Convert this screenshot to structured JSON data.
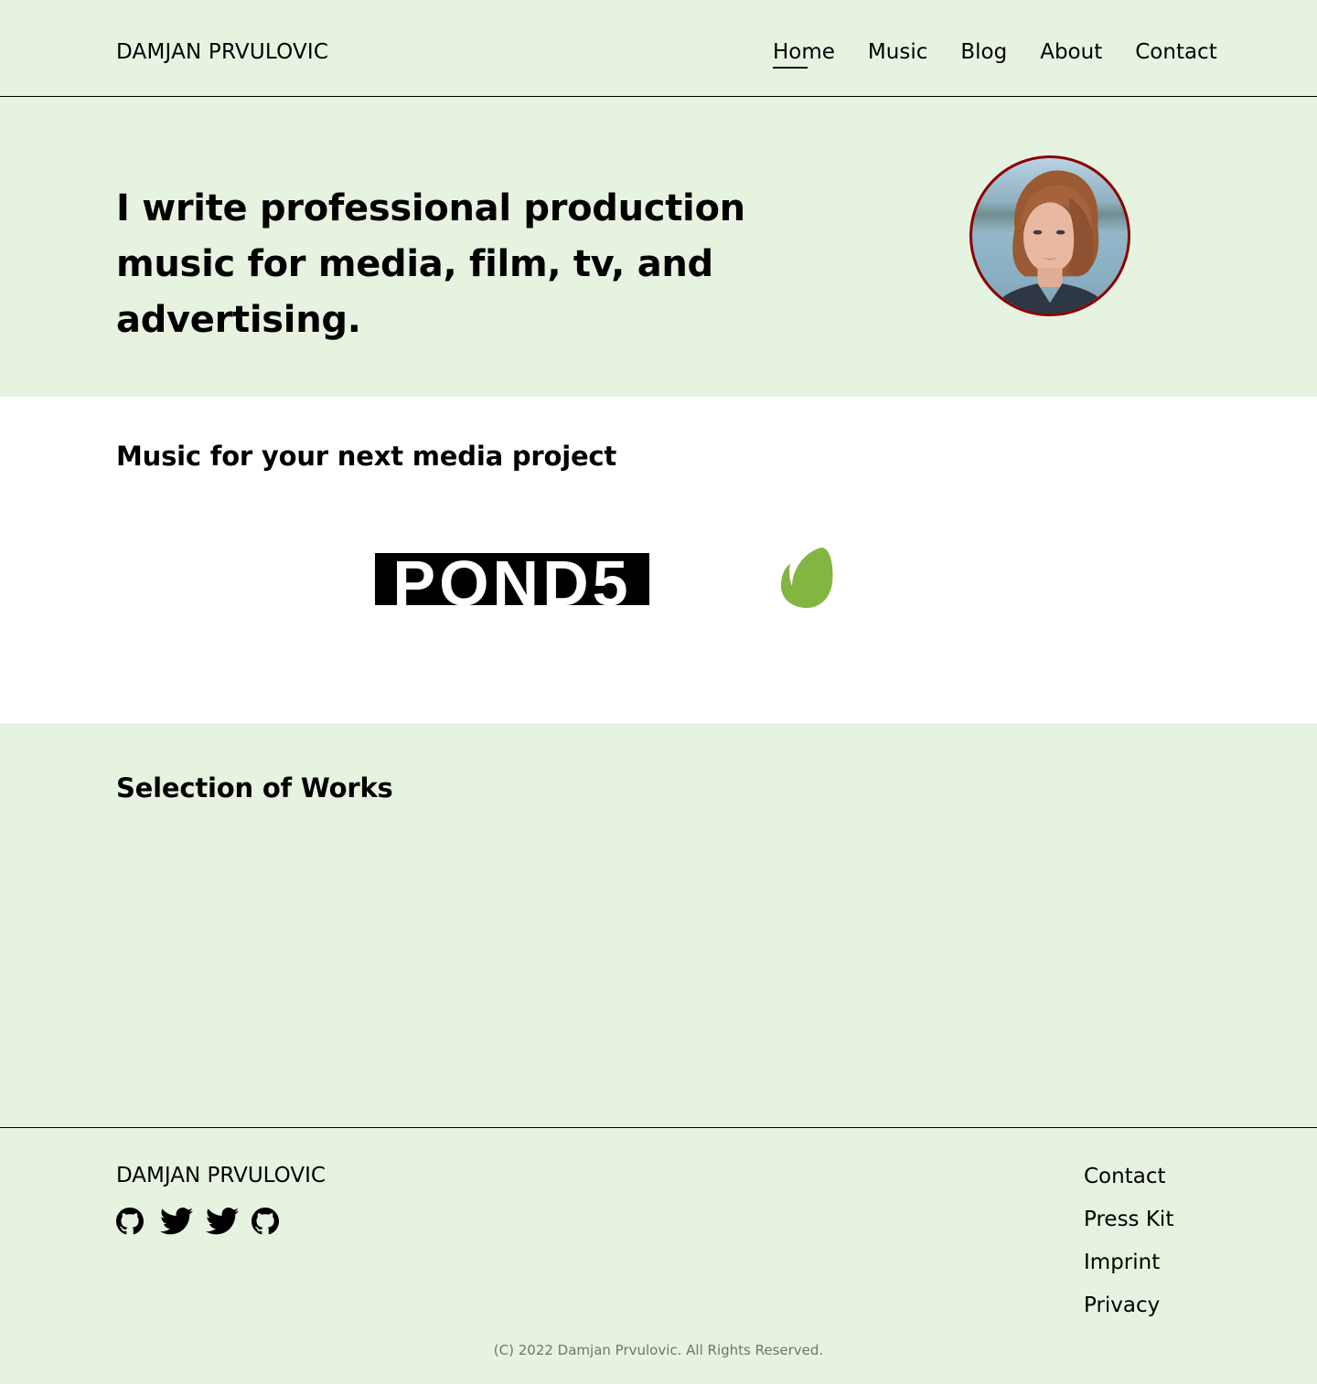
{
  "header": {
    "brand": "DAMJAN PRVULOVIC",
    "nav": [
      {
        "label": "Home",
        "active": true
      },
      {
        "label": "Music",
        "active": false
      },
      {
        "label": "Blog",
        "active": false
      },
      {
        "label": "About",
        "active": false
      },
      {
        "label": "Contact",
        "active": false
      }
    ]
  },
  "hero": {
    "title": "I write professional production music for media, film, tv, and advertising.",
    "avatar_alt": "portrait photo"
  },
  "partners": {
    "title": "Music for your next media project",
    "logos": [
      {
        "name": "Pond5",
        "text": "POND5"
      },
      {
        "name": "Envato",
        "color": "#82b541"
      }
    ]
  },
  "works": {
    "title": "Selection of Works"
  },
  "footer": {
    "brand": "DAMJAN PRVULOVIC",
    "socials": [
      {
        "icon": "github-icon"
      },
      {
        "icon": "twitter-icon"
      },
      {
        "icon": "twitter-icon"
      },
      {
        "icon": "github-icon"
      }
    ],
    "links": [
      "Contact",
      "Press Kit",
      "Imprint",
      "Privacy"
    ],
    "copyright": "(C) 2022 Damjan Prvulovic. All Rights Reserved."
  },
  "colors": {
    "background": "#e7f3e1",
    "avatar_border": "#8b0000",
    "envato_green": "#82b541",
    "copyright_text": "#6a7a68"
  }
}
